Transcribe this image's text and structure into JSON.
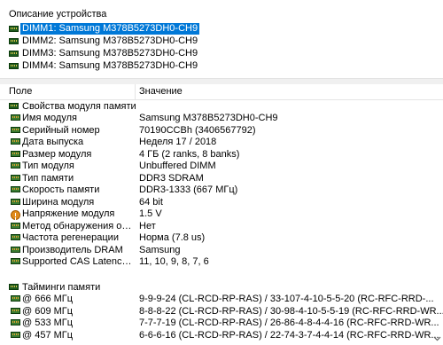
{
  "device_section": {
    "label": "Описание устройства",
    "devices": [
      {
        "label": "DIMM1: Samsung M378B5273DH0-CH9",
        "selected": true
      },
      {
        "label": "DIMM2: Samsung M378B5273DH0-CH9",
        "selected": false
      },
      {
        "label": "DIMM3: Samsung M378B5273DH0-CH9",
        "selected": false
      },
      {
        "label": "DIMM4: Samsung M378B5273DH0-CH9",
        "selected": false
      }
    ]
  },
  "table": {
    "columns": {
      "field": "Поле",
      "value": "Значение"
    },
    "group1": {
      "title": "Свойства модуля памяти",
      "rows": [
        {
          "field": "Имя модуля",
          "value": "Samsung M378B5273DH0-CH9",
          "icon": "memory-module-icon"
        },
        {
          "field": "Серийный номер",
          "value": "70190CCBh (3406567792)",
          "icon": "memory-module-icon"
        },
        {
          "field": "Дата выпуска",
          "value": "Неделя 17 / 2018",
          "icon": "memory-module-icon"
        },
        {
          "field": "Размер модуля",
          "value": "4 ГБ (2 ranks, 8 banks)",
          "icon": "memory-module-icon"
        },
        {
          "field": "Тип модуля",
          "value": "Unbuffered DIMM",
          "icon": "memory-module-icon"
        },
        {
          "field": "Тип памяти",
          "value": "DDR3 SDRAM",
          "icon": "memory-module-icon"
        },
        {
          "field": "Скорость памяти",
          "value": "DDR3-1333 (667 МГц)",
          "icon": "memory-module-icon"
        },
        {
          "field": "Ширина модуля",
          "value": "64 bit",
          "icon": "memory-module-icon"
        },
        {
          "field": "Напряжение модуля",
          "value": "1.5 V",
          "icon": "voltage-icon"
        },
        {
          "field": "Метод обнаружения ошиб...",
          "value": "Нет",
          "icon": "memory-module-icon"
        },
        {
          "field": "Частота регенерации",
          "value": "Норма (7.8 us)",
          "icon": "memory-module-icon"
        },
        {
          "field": "Производитель DRAM",
          "value": "Samsung",
          "icon": "memory-module-icon"
        },
        {
          "field": "Supported CAS Latencies",
          "value": "11, 10, 9, 8, 7, 6",
          "icon": "memory-module-icon"
        }
      ]
    },
    "group2": {
      "title": "Тайминги памяти",
      "rows": [
        {
          "field": "@ 666 МГц",
          "value": "9-9-9-24  (CL-RCD-RP-RAS) / 33-107-4-10-5-5-20  (RC-RFC-RRD-..."
        },
        {
          "field": "@ 609 МГц",
          "value": "8-8-8-22  (CL-RCD-RP-RAS) / 30-98-4-10-5-5-19  (RC-RFC-RRD-WR..."
        },
        {
          "field": "@ 533 МГц",
          "value": "7-7-7-19  (CL-RCD-RP-RAS) / 26-86-4-8-4-4-16  (RC-RFC-RRD-WR..."
        },
        {
          "field": "@ 457 МГц",
          "value": "6-6-6-16  (CL-RCD-RP-RAS) / 22-74-3-7-4-4-14  (RC-RFC-RRD-WR..."
        }
      ]
    }
  }
}
